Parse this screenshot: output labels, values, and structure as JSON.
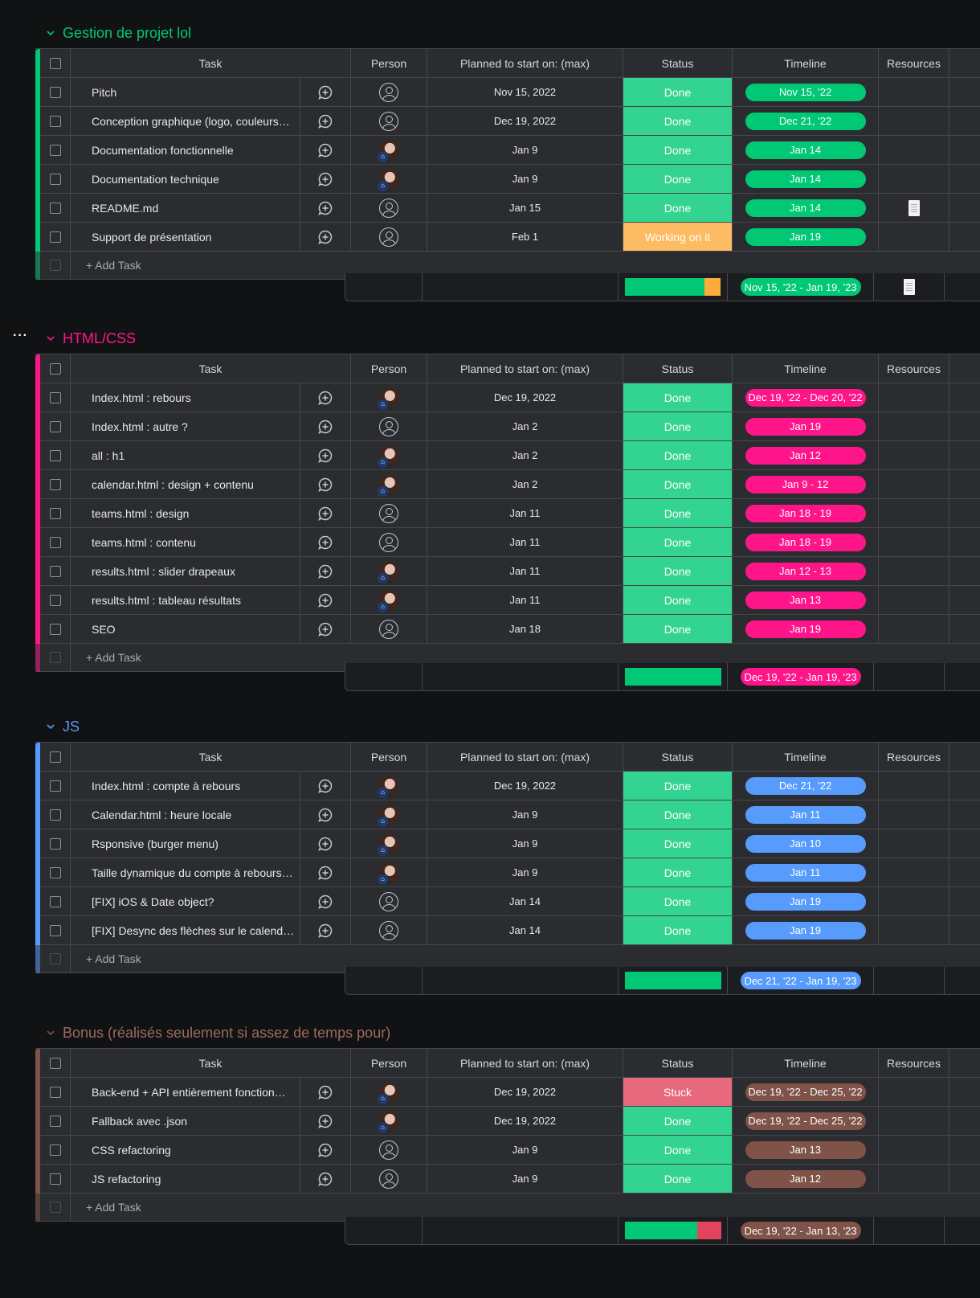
{
  "headers": {
    "task": "Task",
    "person": "Person",
    "planned": "Planned to start on: (max)",
    "status": "Status",
    "timeline": "Timeline",
    "resources": "Resources"
  },
  "add_task_label": "+ Add Task",
  "colors": {
    "done": "#33d391",
    "working": "#fdbc64",
    "stuck": "#e8697d",
    "done_bar": "#00c875",
    "working_bar": "#fdab3d",
    "stuck_bar": "#e2445c"
  },
  "groups": [
    {
      "title": "Gestion de projet lol",
      "color": "#00c875",
      "show_menu": false,
      "rows": [
        {
          "task": "Pitch",
          "person": "empty",
          "planned": "Nov 15, 2022",
          "status": "Done",
          "timeline": "Nov 15, '22",
          "resource": false
        },
        {
          "task": "Conception graphique (logo, couleurs…",
          "person": "empty",
          "planned": "Dec 19, 2022",
          "status": "Done",
          "timeline": "Dec 21, '22",
          "resource": false
        },
        {
          "task": "Documentation fonctionnelle",
          "person": "avatar",
          "planned": "Jan 9",
          "status": "Done",
          "timeline": "Jan 14",
          "resource": false
        },
        {
          "task": "Documentation technique",
          "person": "avatar",
          "planned": "Jan 9",
          "status": "Done",
          "timeline": "Jan 14",
          "resource": false
        },
        {
          "task": "README.md",
          "person": "empty",
          "planned": "Jan 15",
          "status": "Done",
          "timeline": "Jan 14",
          "resource": true
        },
        {
          "task": "Support de présentation",
          "person": "empty",
          "planned": "Feb 1",
          "status": "Working on it",
          "timeline": "Jan 19",
          "resource": false
        }
      ],
      "summary": {
        "timeline": "Nov 15, '22 - Jan 19, '23",
        "resource": true,
        "bar": [
          {
            "status": "done",
            "fraction": 0.833
          },
          {
            "status": "working",
            "fraction": 0.167
          }
        ]
      }
    },
    {
      "title": "HTML/CSS",
      "color": "#ff158a",
      "show_menu": true,
      "menu_label": "···",
      "rows": [
        {
          "task": "Index.html : rebours",
          "person": "avatar",
          "planned": "Dec 19, 2022",
          "status": "Done",
          "timeline": "Dec 19, '22 - Dec 20, '22",
          "resource": false
        },
        {
          "task": "Index.html : autre ?",
          "person": "empty",
          "planned": "Jan 2",
          "status": "Done",
          "timeline": "Jan 19",
          "resource": false
        },
        {
          "task": "all : h1",
          "person": "avatar",
          "planned": "Jan 2",
          "status": "Done",
          "timeline": "Jan 12",
          "resource": false
        },
        {
          "task": "calendar.html : design + contenu",
          "person": "avatar",
          "planned": "Jan 2",
          "status": "Done",
          "timeline": "Jan 9 - 12",
          "resource": false
        },
        {
          "task": "teams.html : design",
          "person": "empty",
          "planned": "Jan 11",
          "status": "Done",
          "timeline": "Jan 18 - 19",
          "resource": false
        },
        {
          "task": "teams.html : contenu",
          "person": "empty",
          "planned": "Jan 11",
          "status": "Done",
          "timeline": "Jan 18 - 19",
          "resource": false
        },
        {
          "task": "results.html : slider drapeaux",
          "person": "avatar",
          "planned": "Jan 11",
          "status": "Done",
          "timeline": "Jan 12 - 13",
          "resource": false
        },
        {
          "task": "results.html : tableau résultats",
          "person": "avatar",
          "planned": "Jan 11",
          "status": "Done",
          "timeline": "Jan 13",
          "resource": false
        },
        {
          "task": "SEO",
          "person": "empty",
          "planned": "Jan 18",
          "status": "Done",
          "timeline": "Jan 19",
          "resource": false
        }
      ],
      "summary": {
        "timeline": "Dec 19, '22 - Jan 19, '23",
        "resource": false,
        "bar": [
          {
            "status": "done",
            "fraction": 1
          }
        ]
      }
    },
    {
      "title": "JS",
      "color": "#579bfc",
      "show_menu": false,
      "rows": [
        {
          "task": "Index.html : compte à rebours",
          "person": "avatar",
          "planned": "Dec 19, 2022",
          "status": "Done",
          "timeline": "Dec 21, '22",
          "resource": false
        },
        {
          "task": "Calendar.html : heure locale",
          "person": "avatar",
          "planned": "Jan 9",
          "status": "Done",
          "timeline": "Jan 11",
          "resource": false
        },
        {
          "task": "Rsponsive (burger menu)",
          "person": "avatar",
          "planned": "Jan 9",
          "status": "Done",
          "timeline": "Jan 10",
          "resource": false
        },
        {
          "task": "Taille dynamique du compte à rebours…",
          "person": "avatar",
          "planned": "Jan 9",
          "status": "Done",
          "timeline": "Jan 11",
          "resource": false
        },
        {
          "task": "[FIX] iOS & Date object?",
          "person": "empty",
          "planned": "Jan 14",
          "status": "Done",
          "timeline": "Jan 19",
          "resource": false
        },
        {
          "task": "[FIX] Desync des flèches sur le calend…",
          "person": "empty",
          "planned": "Jan 14",
          "status": "Done",
          "timeline": "Jan 19",
          "resource": false
        }
      ],
      "summary": {
        "timeline": "Dec 21, '22 - Jan 19, '23",
        "resource": false,
        "bar": [
          {
            "status": "done",
            "fraction": 1
          }
        ]
      }
    },
    {
      "title": "Bonus (réalisés seulement si assez de temps pour)",
      "color": "#7f5347",
      "title_color": "#9d6b5e",
      "show_menu": false,
      "rows": [
        {
          "task": "Back-end + API entièrement fonction…",
          "person": "avatar",
          "planned": "Dec 19, 2022",
          "status": "Stuck",
          "timeline": "Dec 19, '22 - Dec 25, '22",
          "resource": false
        },
        {
          "task": "Fallback avec .json",
          "person": "avatar",
          "planned": "Dec 19, 2022",
          "status": "Done",
          "timeline": "Dec 19, '22 - Dec 25, '22",
          "resource": false
        },
        {
          "task": "CSS refactoring",
          "person": "empty",
          "planned": "Jan 9",
          "status": "Done",
          "timeline": "Jan 13",
          "resource": false
        },
        {
          "task": "JS refactoring",
          "person": "empty",
          "planned": "Jan 9",
          "status": "Done",
          "timeline": "Jan 12",
          "resource": false
        }
      ],
      "summary": {
        "timeline": "Dec 19, '22 - Jan 13, '23",
        "resource": false,
        "bar": [
          {
            "status": "done",
            "fraction": 0.75
          },
          {
            "status": "stuck",
            "fraction": 0.25
          }
        ]
      }
    }
  ]
}
